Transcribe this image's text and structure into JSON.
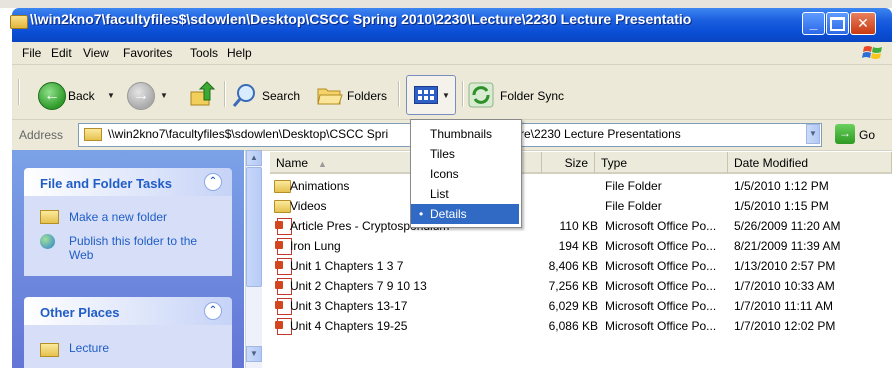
{
  "window": {
    "title": "\\\\win2kno7\\facultyfiles$\\sdowlen\\Desktop\\CSCC Spring 2010\\2230\\Lecture\\2230 Lecture Presentatio"
  },
  "menu": [
    "File",
    "Edit",
    "View",
    "Favorites",
    "Tools",
    "Help"
  ],
  "toolbar": {
    "back_label": "Back",
    "search_label": "Search",
    "folders_label": "Folders",
    "folder_sync_label": "Folder Sync"
  },
  "address": {
    "label": "Address",
    "value_start": "\\\\win2kno7\\facultyfiles$\\sdowlen\\Desktop\\CSCC Spri",
    "value_end": "re\\2230 Lecture Presentations",
    "go_label": "Go"
  },
  "task_pane": {
    "file_tasks_title": "File and Folder Tasks",
    "file_tasks": [
      "Make a new folder",
      "Publish this folder to the Web"
    ],
    "other_places_title": "Other Places",
    "other_places": [
      "Lecture"
    ]
  },
  "view_menu": {
    "items": [
      "Thumbnails",
      "Tiles",
      "Icons",
      "List",
      "Details"
    ],
    "selected": "Details"
  },
  "columns": {
    "name": "Name",
    "size": "Size",
    "type": "Type",
    "date": "Date Modified"
  },
  "files": [
    {
      "name": "Animations",
      "size": "",
      "type": "File Folder",
      "date": "1/5/2010 1:12 PM",
      "icon": "folder-icon"
    },
    {
      "name": "Videos",
      "size": "",
      "type": "File Folder",
      "date": "1/5/2010 1:15 PM",
      "icon": "folder-icon"
    },
    {
      "name": "Article Pres - Cryptosporidium",
      "size": "110 KB",
      "type": "Microsoft Office Po...",
      "date": "5/26/2009 11:20 AM",
      "icon": "powerpoint-icon"
    },
    {
      "name": "Iron Lung",
      "size": "194 KB",
      "type": "Microsoft Office Po...",
      "date": "8/21/2009 11:39 AM",
      "icon": "powerpoint-icon"
    },
    {
      "name": "Unit 1 Chapters 1 3 7",
      "size": "8,406 KB",
      "type": "Microsoft Office Po...",
      "date": "1/13/2010 2:57 PM",
      "icon": "powerpoint-icon"
    },
    {
      "name": "Unit 2 Chapters 7 9 10 13",
      "size": "7,256 KB",
      "type": "Microsoft Office Po...",
      "date": "1/7/2010 10:33 AM",
      "icon": "powerpoint-icon"
    },
    {
      "name": "Unit 3 Chapters 13-17",
      "size": "6,029 KB",
      "type": "Microsoft Office Po...",
      "date": "1/7/2010 11:11 AM",
      "icon": "powerpoint-icon"
    },
    {
      "name": "Unit 4 Chapters 19-25",
      "size": "6,086 KB",
      "type": "Microsoft Office Po...",
      "date": "1/7/2010 12:02 PM",
      "icon": "powerpoint-icon"
    }
  ],
  "colors": {
    "titlebar": "#0a4fd6",
    "menu_bg": "#ece9d8",
    "selection": "#316ac5",
    "task_link": "#215dc6"
  }
}
